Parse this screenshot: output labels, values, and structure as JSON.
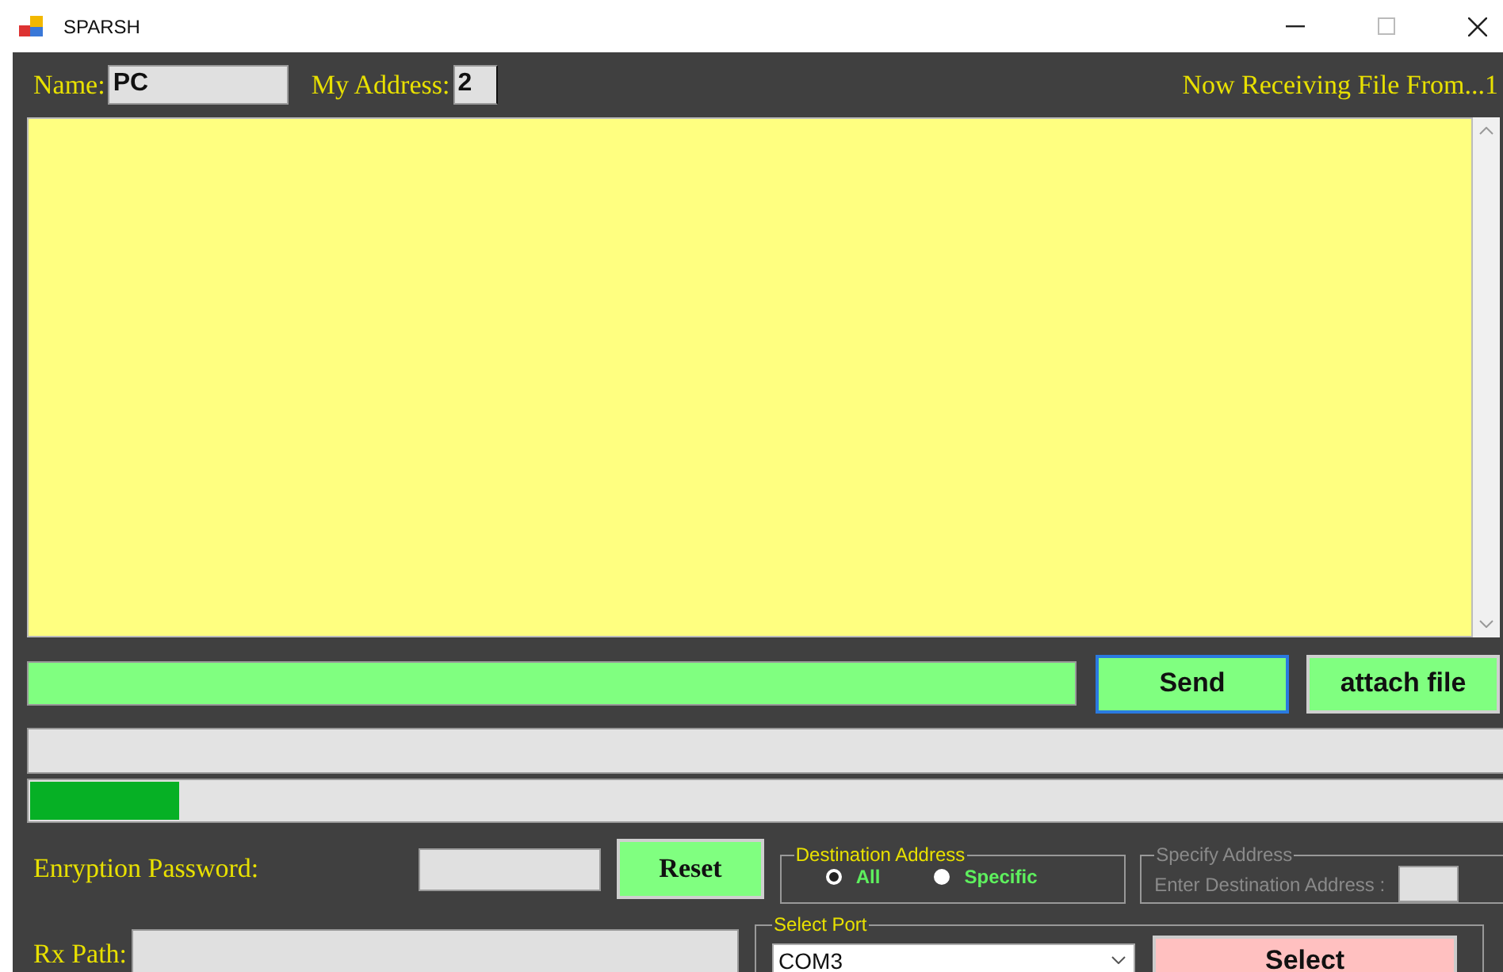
{
  "window": {
    "title": "SPARSH"
  },
  "header": {
    "name_label": "Name:",
    "name_value": "PC",
    "address_label": "My Address:",
    "address_value": "2",
    "status": "Now Receiving File From...1"
  },
  "message": {
    "send": "Send",
    "attach": "attach file"
  },
  "progress": {
    "level": 0.1
  },
  "encryption": {
    "label": "Enryption Password:",
    "reset": "Reset"
  },
  "destination": {
    "title": "Destination Address",
    "options": [
      {
        "label": "All",
        "selected": true
      },
      {
        "label": "Specific",
        "selected": false
      }
    ]
  },
  "specify": {
    "title": "Specify Address",
    "label": "Enter Destination Address :",
    "disabled": true
  },
  "rx": {
    "label": "Rx Path:"
  },
  "port": {
    "title": "Select Port",
    "value": "COM3",
    "button": "Select"
  }
}
